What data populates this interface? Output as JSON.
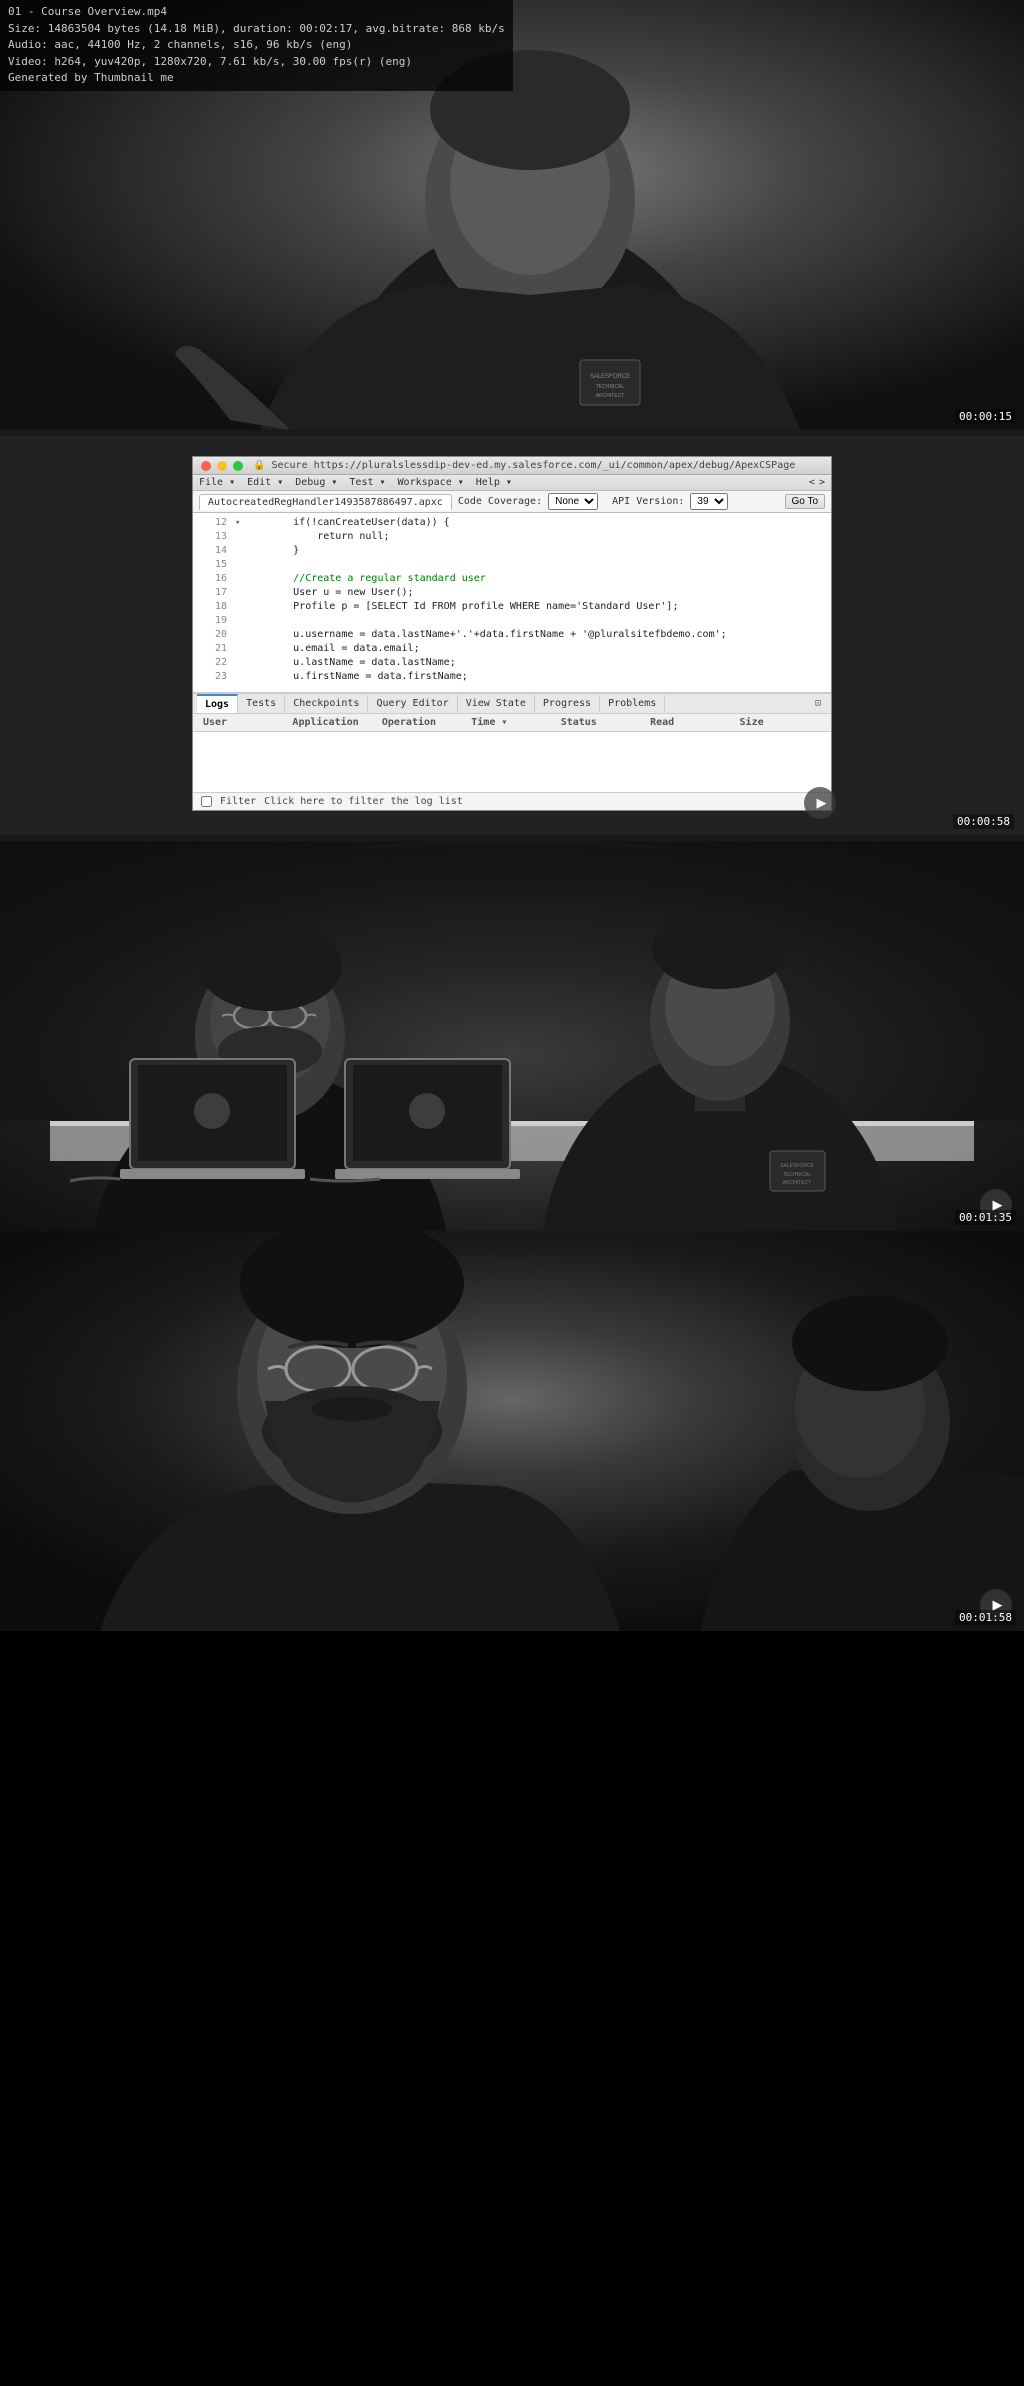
{
  "meta": {
    "filename": "01 - Course Overview.mp4",
    "size": "14863504 bytes (14.18 MiB)",
    "duration": "00:02:17",
    "avg_bitrate": "868 kb/s",
    "audio": "aac, 44100 Hz, 2 channels, s16, 96 kb/s (eng)",
    "video": "h264, yuv420p, 1280x720, 7.61 kb/s, 30.00 fps(r) (eng)",
    "generator": "Generated by Thumbnail me"
  },
  "section1": {
    "timestamp": "00:00:15"
  },
  "ide": {
    "title": "AutocreatedRegHandler1493587886497.apxc",
    "menu_items": [
      "File",
      "Edit",
      "Debug",
      "Test",
      "Workspace",
      "Help"
    ],
    "nav_back": "<",
    "nav_fwd": ">",
    "coverage_label": "Code Coverage:",
    "coverage_value": "None",
    "api_label": "API Version:",
    "api_value": "39",
    "go_to_btn": "Go To",
    "tab_label": "AutocreatedRegHandler1493587886497.apxc",
    "code_lines": [
      {
        "num": "12",
        "arrow": "▾",
        "text": "        if(!canCreateUser(data)) {"
      },
      {
        "num": "13",
        "arrow": "",
        "text": "            return null;"
      },
      {
        "num": "14",
        "arrow": "",
        "text": "        }"
      },
      {
        "num": "15",
        "arrow": "",
        "text": ""
      },
      {
        "num": "16",
        "arrow": "",
        "text": "        //Create a regular standard user"
      },
      {
        "num": "17",
        "arrow": "",
        "text": "        User u = new User();"
      },
      {
        "num": "18",
        "arrow": "",
        "text": "        Profile p = [SELECT Id FROM profile WHERE name='Standard User'];"
      },
      {
        "num": "19",
        "arrow": "",
        "text": ""
      },
      {
        "num": "20",
        "arrow": "",
        "text": "        u.username = data.lastName+'.'+data.firstName + '@pluralsitefbdemo.com';"
      },
      {
        "num": "21",
        "arrow": "",
        "text": "        u.email = data.email;"
      },
      {
        "num": "22",
        "arrow": "",
        "text": "        u.lastName = data.lastName;"
      },
      {
        "num": "23",
        "arrow": "",
        "text": "        u.firstName = data.firstName;"
      }
    ],
    "bottom_tabs": [
      "Logs",
      "Tests",
      "Checkpoints",
      "Query Editor",
      "View State",
      "Progress",
      "Problems"
    ],
    "active_tab": "Logs",
    "log_columns": [
      "User",
      "Application",
      "Operation",
      "Time ▾",
      "Status",
      "Read",
      "Size"
    ],
    "filter_label": "Filter",
    "filter_placeholder": "Click here to filter the log list",
    "timestamp": "00:00:58"
  },
  "section2": {
    "timestamp": "00:01:35"
  },
  "section3": {
    "timestamp": "00:01:58"
  }
}
